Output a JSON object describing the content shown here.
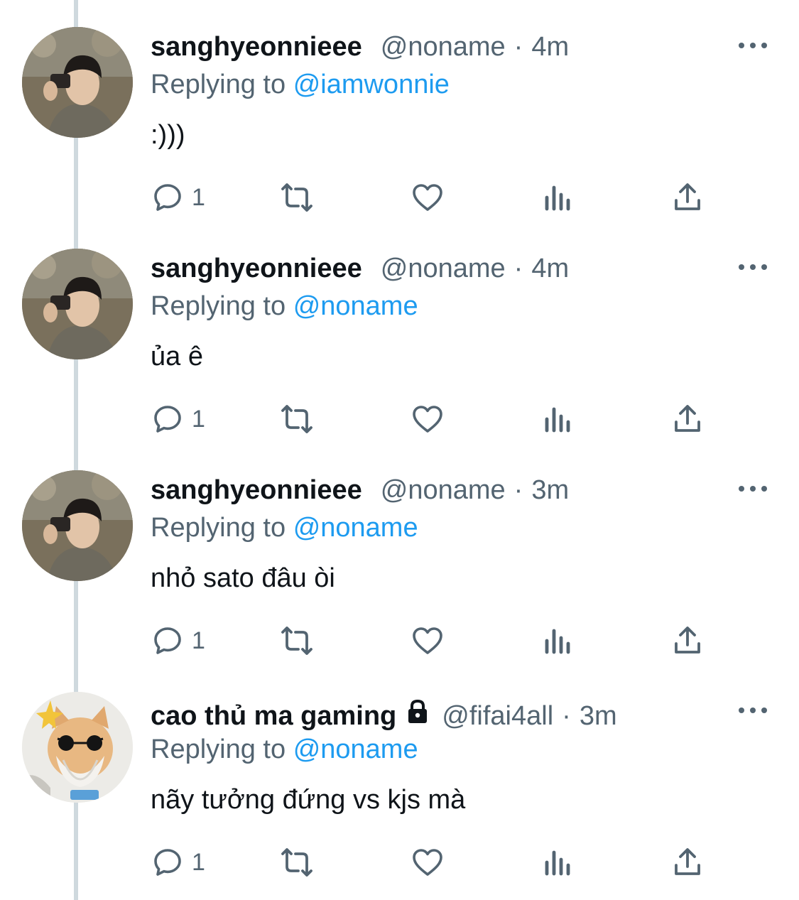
{
  "tweets": [
    {
      "name": "sanghyeonnieee",
      "locked": false,
      "handle": "@noname",
      "separator": "·",
      "time": "4m",
      "replying_prefix": "Replying to",
      "replying_to": "@iamwonnie",
      "text": ":)))",
      "reply_count": "1",
      "avatar": "photo-person-with-camera"
    },
    {
      "name": "sanghyeonnieee",
      "locked": false,
      "handle": "@noname",
      "separator": "·",
      "time": "4m",
      "replying_prefix": "Replying to",
      "replying_to": "@noname",
      "text": "ủa ê",
      "reply_count": "1",
      "avatar": "photo-person-with-camera"
    },
    {
      "name": "sanghyeonnieee",
      "locked": false,
      "handle": "@noname",
      "separator": "·",
      "time": "3m",
      "replying_prefix": "Replying to",
      "replying_to": "@noname",
      "text": "nhỏ sato đâu òi",
      "reply_count": "1",
      "avatar": "photo-person-with-camera"
    },
    {
      "name": "cao thủ ma gaming",
      "locked": true,
      "handle": "@fifai4all",
      "separator": "·",
      "time": "3m",
      "replying_prefix": "Replying to",
      "replying_to": "@noname",
      "text": "nãy tưởng đứng vs kjs mà",
      "reply_count": "1",
      "avatar": "kitten-with-sunglasses"
    }
  ],
  "icons": {
    "reply": "reply-icon",
    "retweet": "retweet-icon",
    "like": "heart-icon",
    "views": "analytics-icon",
    "share": "share-icon",
    "more": "more-options-icon",
    "lock": "lock-icon"
  },
  "colors": {
    "text": "#0f1419",
    "secondary": "#536471",
    "accent": "#1d9bf0",
    "thread_line": "#cfd9de"
  }
}
